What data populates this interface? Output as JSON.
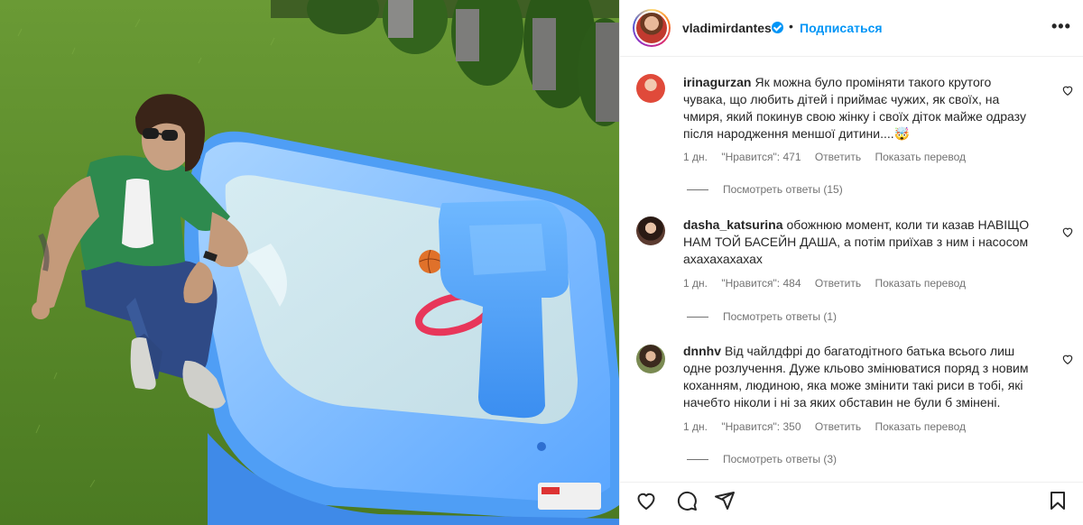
{
  "post": {
    "username": "vladimirdantes",
    "follow_label": "Подписаться",
    "separator": "•",
    "more_label": "•••"
  },
  "comments": [
    {
      "username": "irinagurzan",
      "text": "Як можна було проміняти такого крутого чувака, що любить дітей і приймає чужих, як своїх, на чмиря, який покинув свою жінку і своїх діток майже одразу після народження меншої дитини....🤯",
      "time": "1 дн.",
      "likes": "\"Нравится\": 471",
      "reply_label": "Ответить",
      "translate_label": "Показать перевод",
      "view_replies": "Посмотреть ответы (15)"
    },
    {
      "username": "dasha_katsurina",
      "text": "обожнюю момент, коли ти казав НАВІЩО НАМ ТОЙ БАСЕЙН ДАША, а потім приїхав з ним і насосом ахахахахахах",
      "time": "1 дн.",
      "likes": "\"Нравится\": 484",
      "reply_label": "Ответить",
      "translate_label": "Показать перевод",
      "view_replies": "Посмотреть ответы (1)"
    },
    {
      "username": "dnnhv",
      "text": "Від чайлдфрі до багатодітного батька всього лиш одне розлучення. Дуже кльово змінюватися поряд з новим коханням, людиною, яка може змінити такі риси в тобі, які начебто ніколи і ні за яких обставин не були б змінені.",
      "time": "1 дн.",
      "likes": "\"Нравится\": 350",
      "reply_label": "Ответить",
      "translate_label": "Показать перевод",
      "view_replies": "Посмотреть ответы (3)"
    }
  ],
  "icons": {
    "like": "heart-icon",
    "comment": "comment-icon",
    "share": "share-icon",
    "save": "bookmark-icon"
  },
  "colors": {
    "accent": "#0095f6",
    "text": "#262626",
    "muted": "#737373",
    "border": "#efefef"
  }
}
